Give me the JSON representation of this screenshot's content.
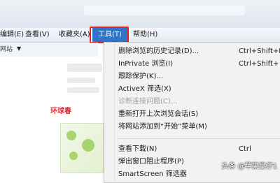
{
  "menubar": {
    "items": [
      "编辑(E)",
      "查看(V)",
      "收藏夹(A)",
      "工具(T)",
      "帮助(H)"
    ]
  },
  "favbar": {
    "label": "网站"
  },
  "page": {
    "promo_text": "环球春"
  },
  "tools_menu": {
    "items": [
      {
        "label": "删除浏览的历史记录(D)...",
        "shortcut": "Ctrl+Shift+D"
      },
      {
        "label": "InPrivate 浏览(I)",
        "shortcut": "Ctrl+Shift+"
      },
      {
        "label": "跟踪保护(K)...",
        "shortcut": ""
      },
      {
        "label": "ActiveX 筛选(X)",
        "shortcut": ""
      },
      {
        "label": "诊断连接问题(C)...",
        "shortcut": "",
        "disabled": true
      },
      {
        "label": "重新打开上次浏览会话(S)",
        "shortcut": ""
      },
      {
        "label": "将网站添加到“开始”菜单(M)",
        "shortcut": ""
      },
      {
        "label": "查看下载(N)",
        "shortcut": "Ctrl"
      },
      {
        "label": "弹出窗口阻止程序(P)",
        "shortcut": ""
      },
      {
        "label": "SmartScreen 筛选器",
        "shortcut": ""
      }
    ]
  },
  "watermark": "头条 @苹果皇仔1"
}
